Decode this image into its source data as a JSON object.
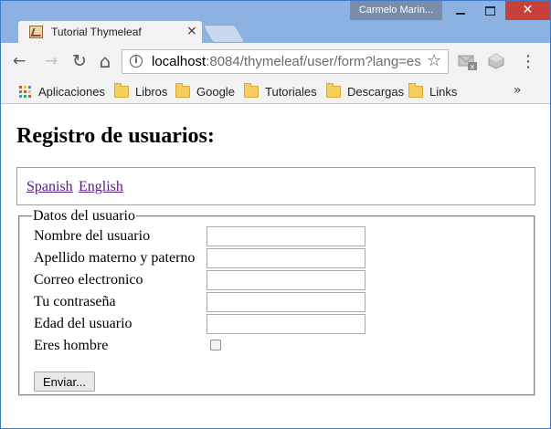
{
  "window": {
    "user_name": "Carmelo Marin...",
    "close_glyph": "✕"
  },
  "tab": {
    "title": "Tutorial Thymeleaf",
    "close_glyph": "×"
  },
  "toolbar": {
    "url_host": "localhost",
    "url_rest": ":8084/thymeleaf/user/form?lang=es",
    "back_glyph": "←",
    "forward_glyph": "→",
    "reload_glyph": "↻",
    "home_glyph": "⌂",
    "star_glyph": "☆",
    "menu_glyph": "⋮"
  },
  "bookmarks": {
    "apps_label": "Aplicaciones",
    "items": [
      "Libros",
      "Google",
      "Tutoriales",
      "Descargas",
      "Links"
    ],
    "more_glyph": "»"
  },
  "page": {
    "title": "Registro de usuarios:",
    "languages": [
      "Spanish",
      "English"
    ],
    "fieldset_legend": "Datos del usuario",
    "fields": [
      {
        "label": "Nombre del usuario",
        "value": ""
      },
      {
        "label": "Apellido materno y paterno",
        "value": ""
      },
      {
        "label": "Correo electronico",
        "value": ""
      },
      {
        "label": "Tu contraseña",
        "value": ""
      },
      {
        "label": "Edad del usuario",
        "value": ""
      }
    ],
    "checkbox_label": "Eres hombre",
    "checkbox_checked": false,
    "submit_label": "Enviar..."
  },
  "colors": {
    "titlebar": "#8cb2e2",
    "close_button": "#c7403a",
    "visited_link": "#551a8b"
  }
}
